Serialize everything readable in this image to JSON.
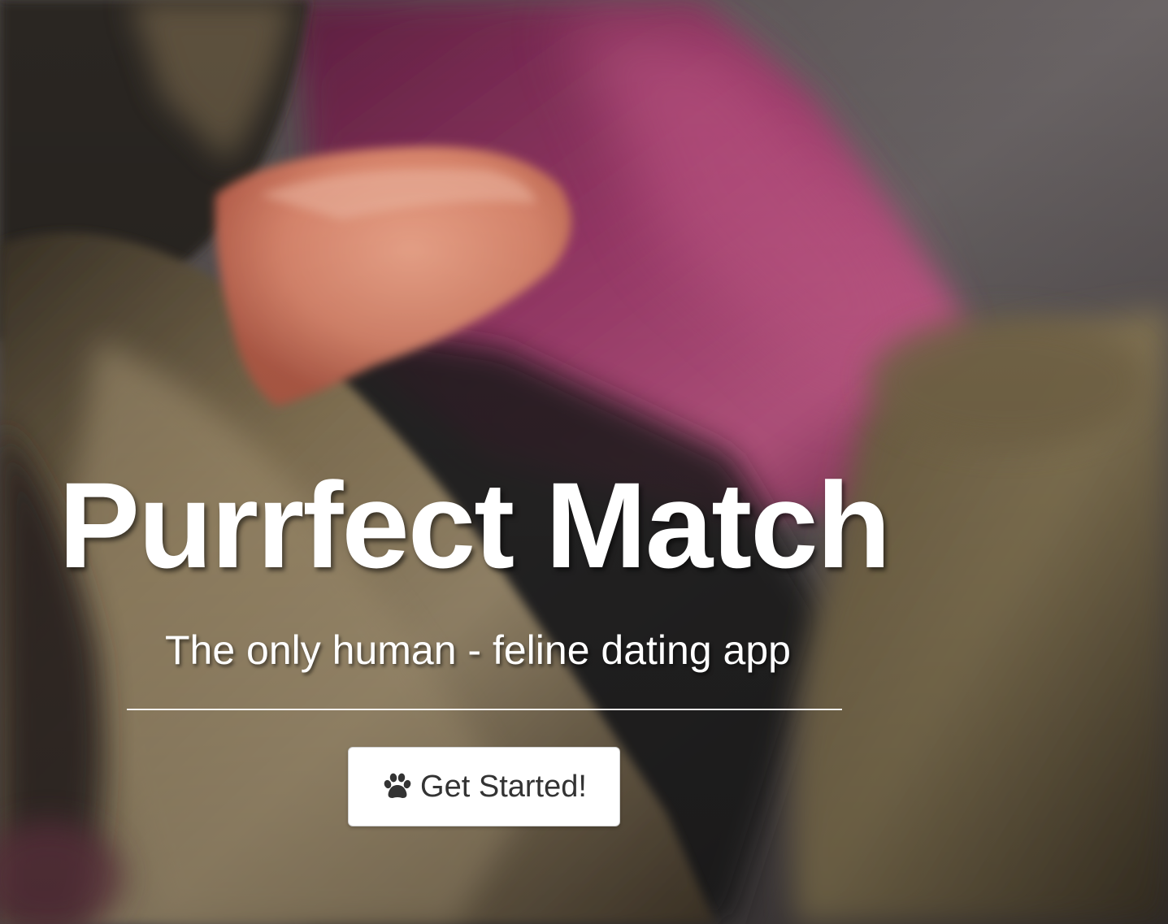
{
  "hero": {
    "title": "Purrfect Match",
    "subtitle": "The only human - feline dating app",
    "cta": {
      "label": "Get Started!",
      "icon": "paw-icon"
    },
    "background": {
      "description_colors": {
        "fur_dark": "#2c2620",
        "fur_light": "#9c8a6a",
        "fingertip": "#e48a72",
        "fabric_magenta": "#8e2f5c",
        "backdrop_grey": "#5d5758"
      }
    }
  },
  "colors": {
    "title_text": "#ffffff",
    "button_bg": "#ffffff",
    "button_text": "#333333",
    "divider": "#ffffff"
  }
}
